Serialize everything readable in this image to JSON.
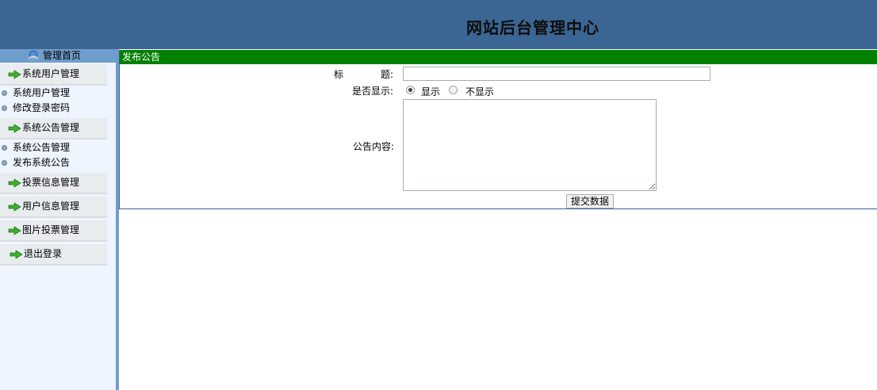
{
  "header": {
    "title": "网站后台管理中心"
  },
  "sidebar": {
    "home_label": "管理首页",
    "sections": [
      {
        "label": "系统用户管理",
        "items": [
          "系统用户管理",
          "修改登录密码"
        ]
      },
      {
        "label": "系统公告管理",
        "items": [
          "系统公告管理",
          "发布系统公告"
        ]
      },
      {
        "label": "投票信息管理",
        "items": []
      },
      {
        "label": "用户信息管理",
        "items": []
      },
      {
        "label": "图片投票管理",
        "items": []
      },
      {
        "label": "退出登录",
        "items": []
      }
    ]
  },
  "main": {
    "panel_title": "发布公告",
    "form": {
      "title_label_1": "标",
      "title_label_2": "题:",
      "title_value": "",
      "show_label": "是否显示:",
      "show_option_yes": "显示",
      "show_option_no": "不显示",
      "show_selected": "显示",
      "content_label": "公告内容:",
      "content_value": "",
      "submit_label": "提交数据"
    }
  },
  "colors": {
    "header_bg": "#3b6592",
    "sidebar_bg": "#eef5ff",
    "sidebar_border": "#6f9dcd",
    "panel_title_bg": "#007f00",
    "menu_head_bg": "#e8ecef"
  }
}
